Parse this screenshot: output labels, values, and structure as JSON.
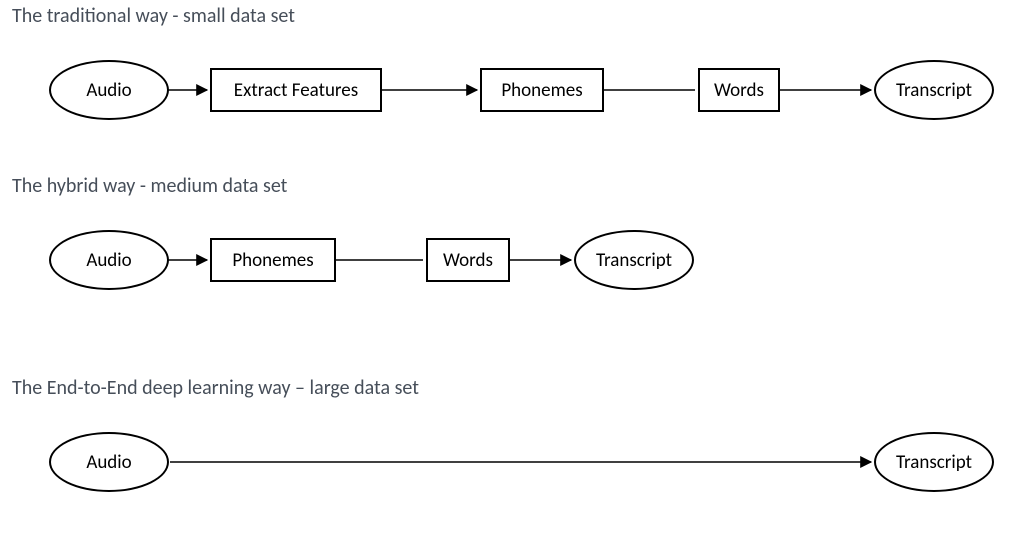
{
  "headings": {
    "h1": "The traditional way - small data set",
    "h2": "The hybrid way - medium data set",
    "h3": "The End-to-End deep learning way – large data set"
  },
  "row1": {
    "audio": "Audio",
    "extract": "Extract Features",
    "phonemes": "Phonemes",
    "words": "Words",
    "transcript": "Transcript"
  },
  "row2": {
    "audio": "Audio",
    "phonemes": "Phonemes",
    "words": "Words",
    "transcript": "Transcript"
  },
  "row3": {
    "audio": "Audio",
    "transcript": "Transcript"
  }
}
